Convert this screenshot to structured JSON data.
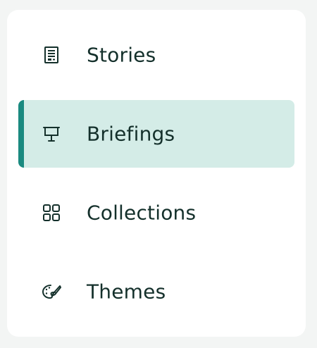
{
  "nav": {
    "active_index": 1,
    "accent_color": "#1a8a80",
    "active_bg": "#d4ece7",
    "text_color": "#14302b",
    "items": [
      {
        "label": "Stories",
        "icon": "document-icon"
      },
      {
        "label": "Briefings",
        "icon": "presentation-icon"
      },
      {
        "label": "Collections",
        "icon": "grid-icon"
      },
      {
        "label": "Themes",
        "icon": "palette-icon"
      }
    ]
  }
}
